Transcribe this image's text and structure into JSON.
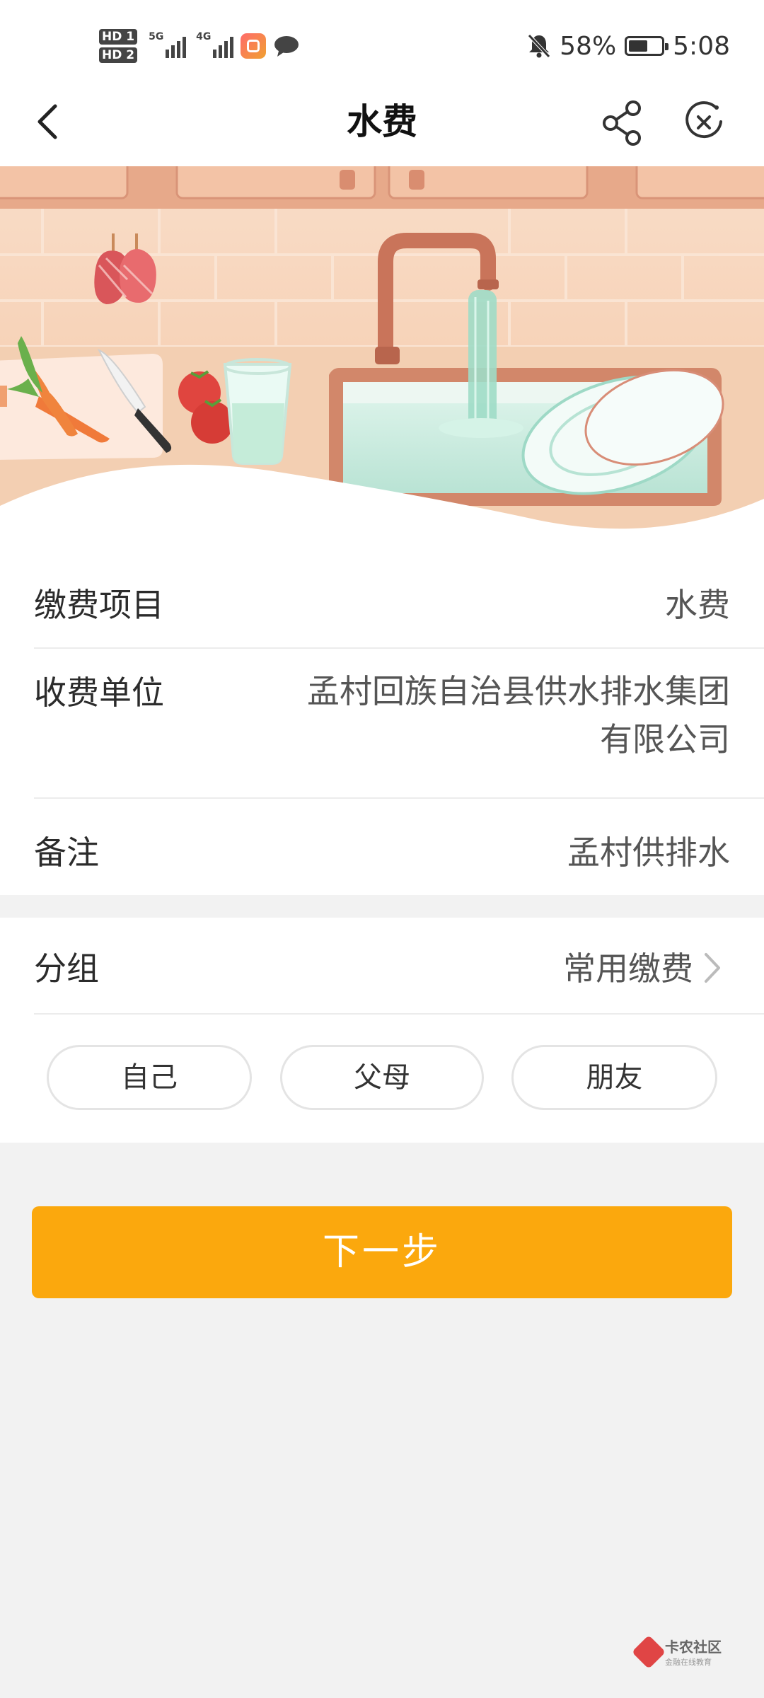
{
  "status_bar": {
    "hd1": "HD",
    "hd1_sim": "1",
    "hd2": "HD",
    "hd2_sim": "2",
    "net1": "5G",
    "net2": "4G",
    "battery_percent": "58%",
    "battery_level": 0.58,
    "time": "5:08",
    "icons": [
      "hd-icon",
      "signal-icon",
      "app-notification-icon",
      "message-icon",
      "mute-bell-icon",
      "battery-icon"
    ]
  },
  "nav": {
    "title": "水费",
    "back_icon": "chevron-left-icon",
    "share_icon": "share-icon",
    "close_icon": "close-circle-icon"
  },
  "details": {
    "item_label": "缴费项目",
    "item_value": "水费",
    "unit_label": "收费单位",
    "unit_value_line1": "孟村回族自治县供水排水集团",
    "unit_value_line2": "有限公司",
    "note_label": "备注",
    "note_value": "孟村供排水"
  },
  "group": {
    "label": "分组",
    "value": "常用缴费",
    "chips": [
      "自己",
      "父母",
      "朋友"
    ]
  },
  "actions": {
    "next_label": "下一步"
  },
  "watermark": {
    "title": "卡农社区",
    "subtitle": "金融在线教育"
  },
  "colors": {
    "accent": "#fba80d",
    "background": "#f2f2f2",
    "card": "#ffffff"
  }
}
